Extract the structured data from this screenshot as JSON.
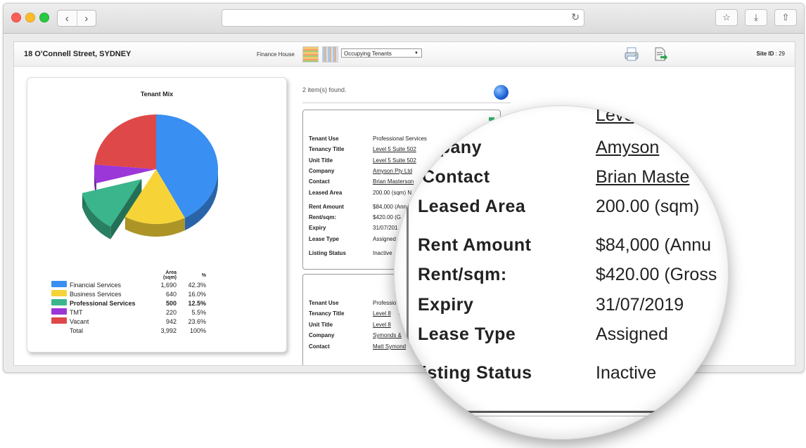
{
  "header": {
    "site_title": "18 O'Connell Street, SYDNEY",
    "finance_label": "Finance House",
    "view_select": "Occupying Tenants",
    "site_id_label": "Site ID",
    "site_id_value": ": 29"
  },
  "icons": {
    "back": "chevron-left-icon",
    "forward": "chevron-right-icon",
    "reload": "reload-icon",
    "bookmark": "star-icon",
    "download": "download-icon",
    "share": "share-icon",
    "print": "print-icon",
    "export": "export-icon",
    "globe": "globe-icon"
  },
  "chart_data": {
    "type": "pie",
    "title": "Tenant Mix",
    "columns": [
      "Area (sqm)",
      "%"
    ],
    "slices": [
      {
        "name": "Financial Services",
        "area": "1,690",
        "pct": "42.3%",
        "value": 42.3,
        "color": "#3a8ff2",
        "exploded": false
      },
      {
        "name": "Business Services",
        "area": "640",
        "pct": "16.0%",
        "value": 16.0,
        "color": "#f6d437",
        "exploded": false
      },
      {
        "name": "Professional Services",
        "area": "500",
        "pct": "12.5%",
        "value": 12.5,
        "color": "#3ab58c",
        "exploded": true
      },
      {
        "name": "TMT",
        "area": "220",
        "pct": "5.5%",
        "value": 5.5,
        "color": "#9b36d8",
        "exploded": false
      },
      {
        "name": "Vacant",
        "area": "942",
        "pct": "23.6%",
        "value": 23.6,
        "color": "#df4848",
        "exploded": false
      }
    ],
    "total": {
      "name": "Total",
      "area": "3,992",
      "pct": "100%"
    }
  },
  "listing": {
    "found_text": "2 item(s) found.",
    "tenant1": {
      "tenant_use": {
        "label": "Tenant Use",
        "value": "Professional Services"
      },
      "tenancy_title": {
        "label": "Tenancy Title",
        "value": "Level 5 Suite 502"
      },
      "unit_title": {
        "label": "Unit Title",
        "value": "Level 5 Suite 502"
      },
      "company": {
        "label": "Company",
        "value": "Amyson Pty Ltd"
      },
      "contact": {
        "label": "Contact",
        "value": "Brian Masterson"
      },
      "leased_area": {
        "label": "Leased Area",
        "value": "200.00 (sqm) N"
      },
      "rent_amount": {
        "label": "Rent Amount",
        "value": "$84,000 (Ann"
      },
      "rent_sqm": {
        "label": "Rent/sqm:",
        "value": "$420.00 (G"
      },
      "expiry": {
        "label": "Expiry",
        "value": "31/07/201"
      },
      "lease_type": {
        "label": "Lease Type",
        "value": "Assigned"
      },
      "listing_status": {
        "label": "Listing Status",
        "value": "Inactive"
      }
    },
    "tenant2": {
      "tenant_use": {
        "label": "Tenant Use",
        "value": "Professio"
      },
      "tenancy_title": {
        "label": "Tenancy Title",
        "value": "Level 8"
      },
      "unit_title": {
        "label": "Unit Title",
        "value": "Level 8"
      },
      "company": {
        "label": "Company",
        "value": "Symonds &"
      },
      "contact": {
        "label": "Contact",
        "value": "Matt Symond"
      }
    }
  },
  "magnifier": {
    "top_val": "Leve",
    "company_label": "mpany",
    "company_value": "Amyson",
    "contact_label": "Contact",
    "contact_value": "Brian Maste",
    "leased_label": "Leased Area",
    "leased_value": "200.00 (sqm)",
    "rent_label": "Rent Amount",
    "rent_value": "$84,000 (Annu",
    "rentsqm_label": "Rent/sqm:",
    "rentsqm_value": "$420.00 (Gross",
    "expiry_label": "Expiry",
    "expiry_value": "31/07/2019",
    "lease_label": "Lease Type",
    "lease_value": "Assigned",
    "status_label": "isting Status",
    "status_value": "Inactive"
  }
}
